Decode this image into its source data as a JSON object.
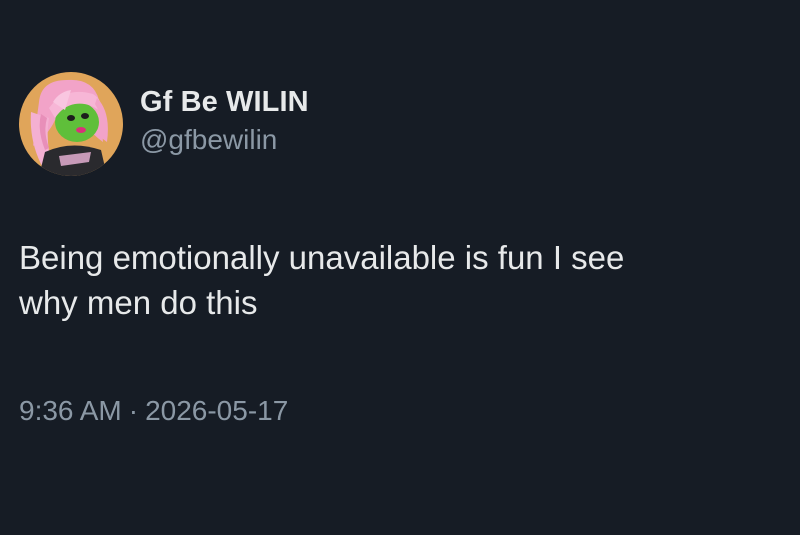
{
  "author": {
    "display_name": "Gf Be WILIN",
    "handle": "@gfbewilin",
    "avatar_icon": "cartoon-avatar-icon"
  },
  "tweet": {
    "text": "Being emotionally unavailable is fun I see\nwhy men do this",
    "time": "9:36 AM",
    "separator": "·",
    "date": "2026-05-17"
  },
  "colors": {
    "background": "#161c25",
    "primary_text": "#e7e9ea",
    "secondary_text": "#8b98a5",
    "avatar_background": "#e0a55a"
  }
}
